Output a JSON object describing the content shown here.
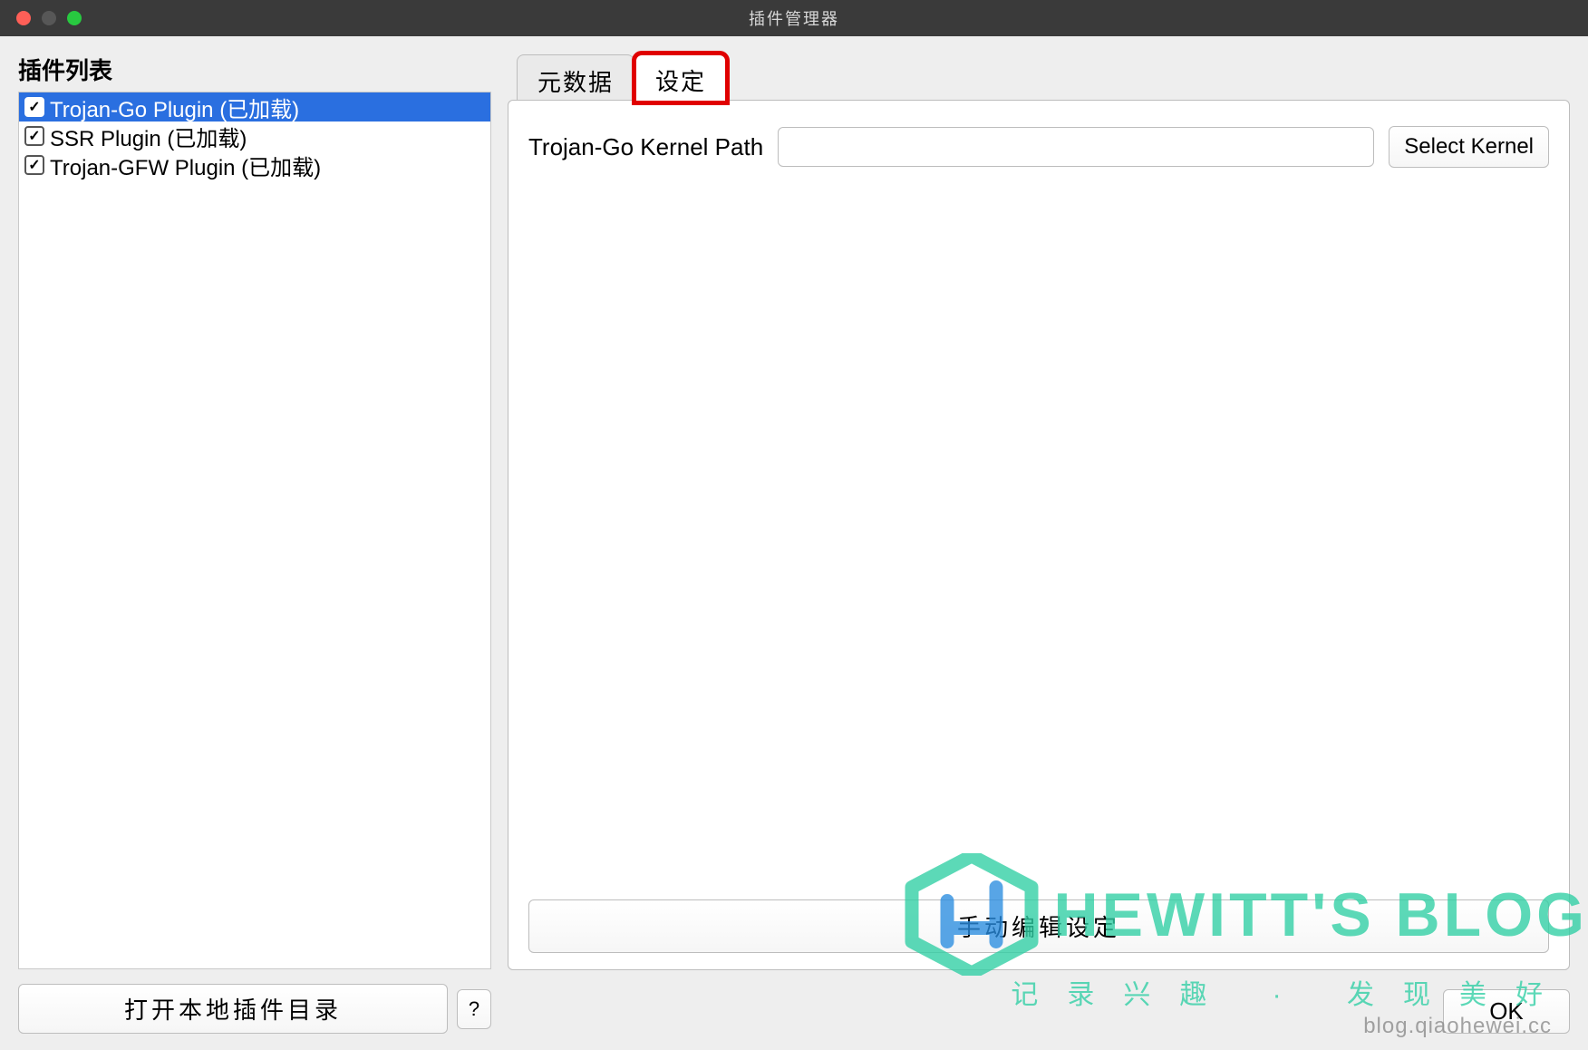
{
  "window": {
    "title": "插件管理器"
  },
  "sidebar": {
    "heading": "插件列表",
    "items": [
      {
        "label": "Trojan-Go Plugin (已加载)",
        "checked": true,
        "selected": true
      },
      {
        "label": "SSR Plugin (已加载)",
        "checked": true,
        "selected": false
      },
      {
        "label": "Trojan-GFW Plugin (已加载)",
        "checked": true,
        "selected": false
      }
    ],
    "open_dir_label": "打开本地插件目录",
    "help_label": "?"
  },
  "main": {
    "tabs": [
      {
        "label": "元数据",
        "active": false
      },
      {
        "label": "设定",
        "active": true
      }
    ],
    "settings": {
      "kernel_path_label": "Trojan-Go Kernel Path",
      "kernel_path_value": "",
      "select_kernel_label": "Select Kernel",
      "manual_edit_label": "手动编辑设定"
    }
  },
  "footer": {
    "ok_label": "OK"
  },
  "watermark": {
    "brand": "HEWITT'S BLOG",
    "tagline": "记录兴趣 · 发现美好",
    "site": "blog.qiaohewei.cc"
  }
}
